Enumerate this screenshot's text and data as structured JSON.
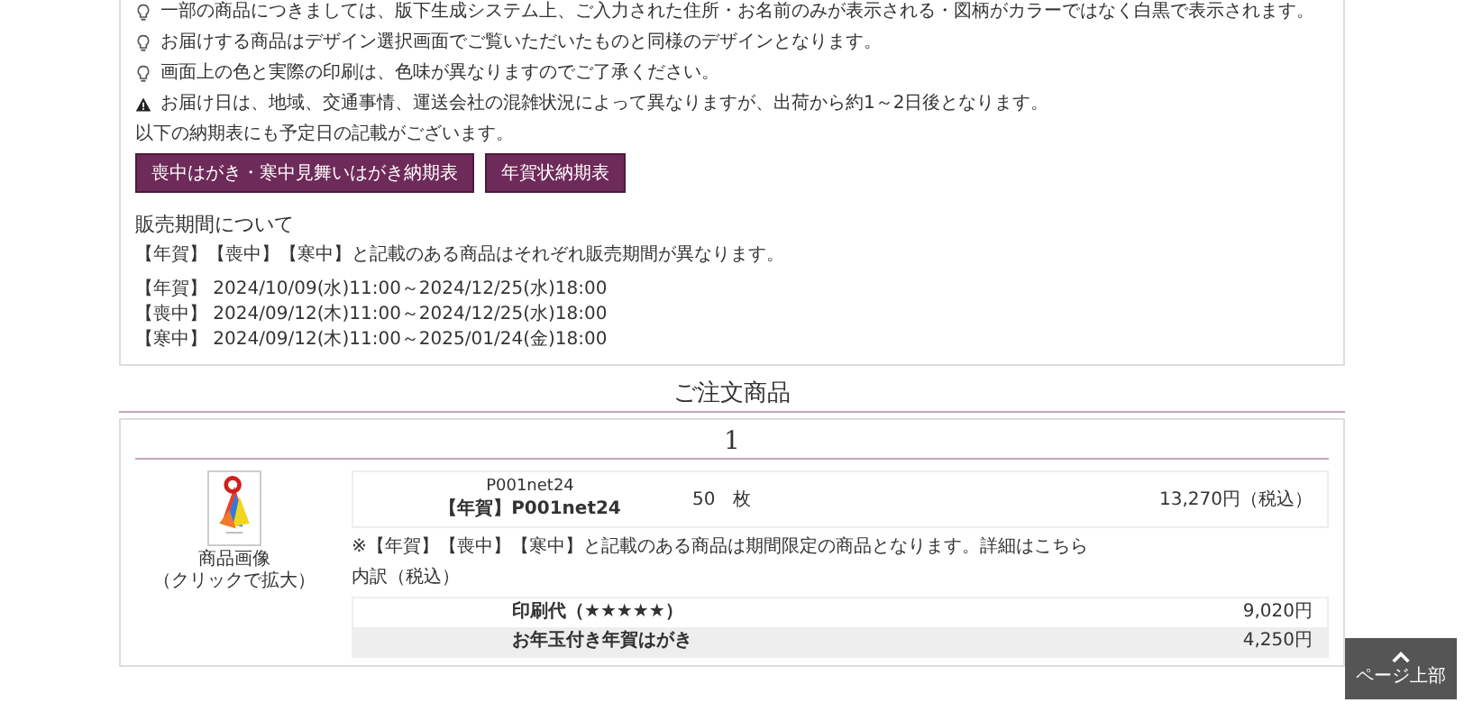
{
  "notices": [
    {
      "kind": "bulb",
      "text": "一部の商品につきましては、版下生成システム上、ご入力された住所・お名前のみが表示される・図柄がカラーではなく白黒で表示されます。"
    },
    {
      "kind": "bulb",
      "text": "お届けする商品はデザイン選択画面でご覧いただいたものと同様のデザインとなります。"
    },
    {
      "kind": "bulb",
      "text": "画面上の色と実際の印刷は、色味が異なりますのでご了承ください。"
    },
    {
      "kind": "warning",
      "text": "お届け日は、地域、交通事情、運送会社の混雑状況によって異なりますが、出荷から約1～2日後となります。"
    }
  ],
  "notice_footer": "以下の納期表にも予定日の記載がございます。",
  "schedule_buttons": [
    "喪中はがき・寒中見舞いはがき納期表",
    "年賀状納期表"
  ],
  "sales_period": {
    "title": "販売期間について",
    "description": "【年賀】【喪中】【寒中】と記載のある商品はそれぞれ販売期間が異なります。",
    "periods": [
      "【年賀】 2024/10/09(水)11:00～2024/12/25(水)18:00",
      "【喪中】 2024/09/12(木)11:00～2024/12/25(水)18:00",
      "【寒中】 2024/09/12(木)11:00～2025/01/24(金)18:00"
    ]
  },
  "order": {
    "title": "ご注文商品",
    "items": [
      {
        "number": "1",
        "image": {
          "kind": "picture"
        },
        "image_caption": "商品画像",
        "image_hint": "（クリックで拡大）",
        "code": "P001net24",
        "name": "【年賀】P001net24",
        "quantity": "50　枚",
        "price": "13,270円（税込）",
        "note": {
          "text": "※【年賀】【喪中】【寒中】と記載のある商品は期間限定の商品となります。",
          "link": "詳細はこちら"
        },
        "breakdown_title": "内訳（税込）",
        "breakdown": [
          {
            "label": "印刷代（★★★★★）",
            "amount": "9,020円"
          },
          {
            "label": "お年玉付き年賀はがき",
            "amount": "4,250円"
          }
        ]
      }
    ]
  },
  "page_top_button": {
    "label": "ページ上部"
  }
}
